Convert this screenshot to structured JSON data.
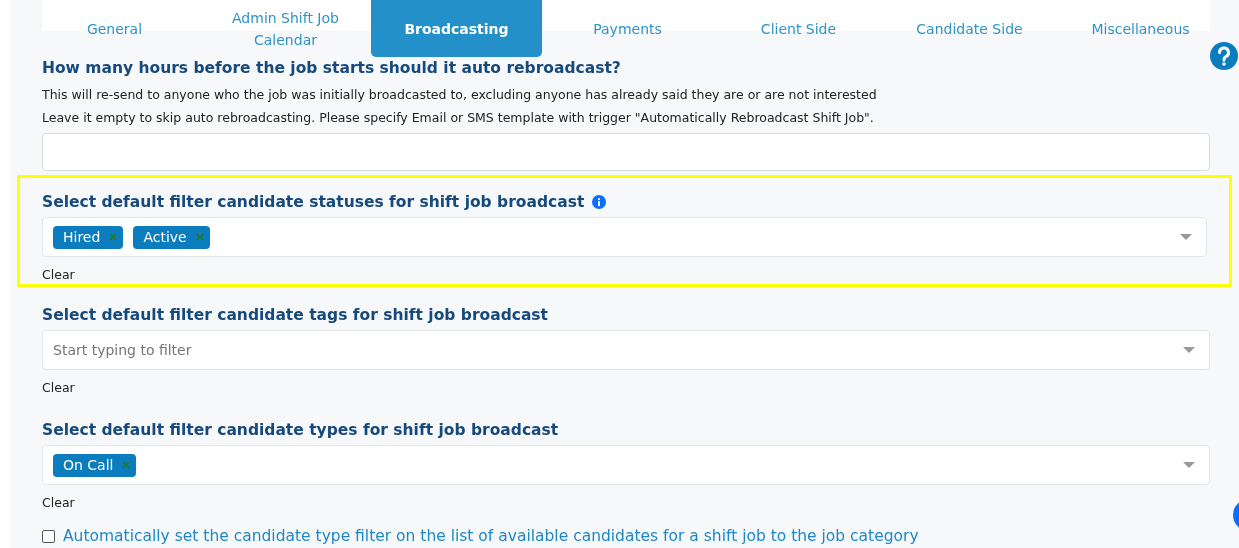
{
  "tabs": [
    {
      "label": "General",
      "selected": false
    },
    {
      "label": "Admin Shift Job Calendar",
      "selected": false
    },
    {
      "label": "Broadcasting",
      "selected": true
    },
    {
      "label": "Payments",
      "selected": false
    },
    {
      "label": "Client Side",
      "selected": false
    },
    {
      "label": "Candidate Side",
      "selected": false
    },
    {
      "label": "Miscellaneous",
      "selected": false
    }
  ],
  "sections": [
    {
      "kind": "text",
      "title": "How many hours before the job starts should it auto rebroadcast?",
      "help_lines": [
        "This will re-send to anyone who the job was initially broadcasted to, excluding anyone has already said they are or are not interested",
        "Leave it empty to skip auto rebroadcasting. Please specify Email or SMS template with trigger \"Automatically Rebroadcast Shift Job\"."
      ],
      "highlighted": false
    },
    {
      "kind": "multiselect",
      "title": "Select default filter candidate statuses for shift job broadcast",
      "info": true,
      "chips": [
        "Hired",
        "Active"
      ],
      "clear": "Clear",
      "highlighted": true
    },
    {
      "kind": "multiselect",
      "title": "Select default filter candidate tags for shift job broadcast",
      "info": false,
      "placeholder": "Start typing to filter",
      "clear": "Clear",
      "highlighted": false
    },
    {
      "kind": "multiselect",
      "title": "Select default filter candidate types for shift job broadcast",
      "info": false,
      "chips": [
        "On Call"
      ],
      "clear": "Clear",
      "highlighted": false
    },
    {
      "kind": "checkbox",
      "label": "Automatically set the candidate type filter on the list of available candidates for a shift job to the job category",
      "checked": false,
      "highlighted": false
    }
  ]
}
